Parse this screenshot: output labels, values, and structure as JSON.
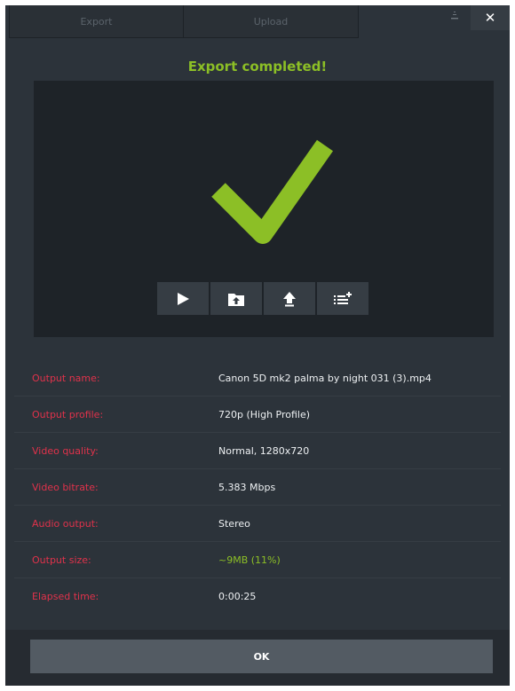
{
  "tabs": [
    {
      "label": "Export"
    },
    {
      "label": "Upload"
    }
  ],
  "window_controls": {
    "minimize_icon": "minimize-icon",
    "close_label": "✕"
  },
  "title": "Export completed!",
  "preview": {
    "status_icon": "checkmark-icon",
    "actions": [
      {
        "icon": "play-icon"
      },
      {
        "icon": "open-folder-icon"
      },
      {
        "icon": "upload-icon"
      },
      {
        "icon": "add-to-list-icon"
      }
    ]
  },
  "details": [
    {
      "label": "Output name:",
      "value": "Canon 5D mk2 palma by night 031 (3).mp4"
    },
    {
      "label": "Output profile:",
      "value": "720p (High Profile)"
    },
    {
      "label": "Video quality:",
      "value": "Normal, 1280x720"
    },
    {
      "label": "Video bitrate:",
      "value": "5.383 Mbps"
    },
    {
      "label": "Audio output:",
      "value": "Stereo"
    },
    {
      "label": "Output size:",
      "value": "~9MB (11%)"
    },
    {
      "label": "Elapsed time:",
      "value": "0:00:25"
    }
  ],
  "ok_label": "OK",
  "colors": {
    "accent_green": "#8cbf26",
    "label_red": "#e0324b",
    "background": "#2c333a"
  }
}
